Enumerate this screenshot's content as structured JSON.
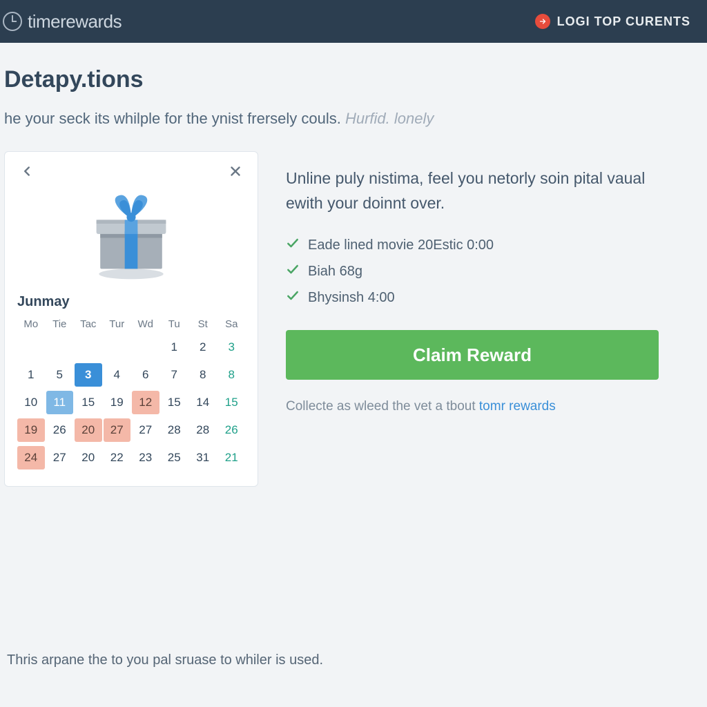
{
  "header": {
    "brand": "timerewards",
    "nav_label": "LOGI TOP CURENTS"
  },
  "page": {
    "title": "Detapy.tions",
    "subtitle_a": "he your seck its whilple for the ynist frersely couls. ",
    "subtitle_b": "Hurfid. lonely"
  },
  "calendar": {
    "month": "Junmay",
    "dow": [
      "Mo",
      "Tie",
      "Tac",
      "Tur",
      "Wd",
      "Tu",
      "St",
      "Sa"
    ],
    "rows": [
      [
        {
          "v": ""
        },
        {
          "v": ""
        },
        {
          "v": ""
        },
        {
          "v": ""
        },
        {
          "v": "1"
        },
        {
          "v": "2"
        },
        {
          "v": "3",
          "teal": true
        }
      ],
      [
        {
          "v": "1"
        },
        {
          "v": "5"
        },
        {
          "v": "3",
          "blue": true
        },
        {
          "v": "4"
        },
        {
          "v": "6"
        },
        {
          "v": "7"
        },
        {
          "v": "8"
        },
        {
          "v": "8",
          "teal": true
        }
      ],
      [
        {
          "v": "10"
        },
        {
          "v": "11",
          "bluelight": true
        },
        {
          "v": "15"
        },
        {
          "v": "19"
        },
        {
          "v": "12",
          "peach": true
        },
        {
          "v": "15"
        },
        {
          "v": "14"
        },
        {
          "v": "15",
          "teal": true
        }
      ],
      [
        {
          "v": "19",
          "peach": true
        },
        {
          "v": "26"
        },
        {
          "v": "20",
          "peach": true
        },
        {
          "v": "27",
          "peach": true
        },
        {
          "v": "27"
        },
        {
          "v": "28"
        },
        {
          "v": "28"
        },
        {
          "v": "26",
          "teal": true
        }
      ],
      [
        {
          "v": "24",
          "peach": true
        },
        {
          "v": "27"
        },
        {
          "v": "20"
        },
        {
          "v": "22"
        },
        {
          "v": "23"
        },
        {
          "v": "25"
        },
        {
          "v": "31"
        },
        {
          "v": "21",
          "teal": true
        }
      ]
    ]
  },
  "right": {
    "heading": "Unline puly nistima, feel you netorly soin pital vaual ewith your doinnt over.",
    "items": [
      "Eade lined movie 20Estic 0:00",
      "Biah 68g",
      "Bhysinsh 4:00"
    ],
    "claim_label": "Claim Reward",
    "collect_a": "Collecte as wleed the vet a tbout ",
    "collect_link": "tomr rewards"
  },
  "footer": "Thris arpane the to you pal sruase to whiler is used."
}
